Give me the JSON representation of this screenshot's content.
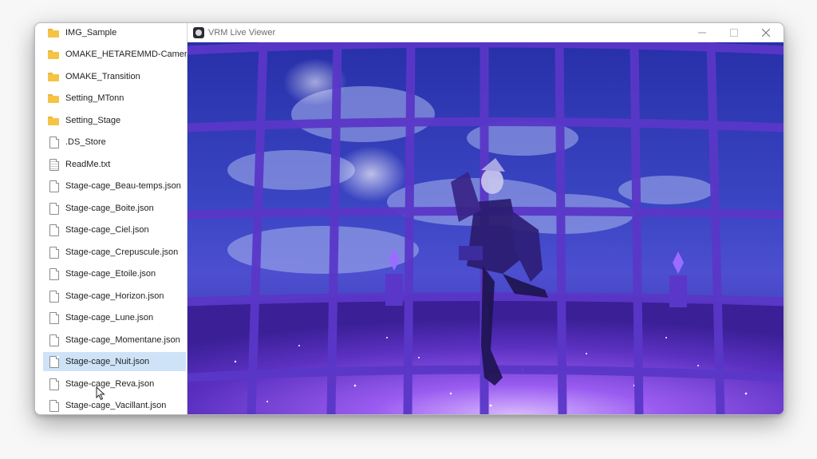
{
  "file_list": [
    {
      "name": "IMG_Sample",
      "type": "folder"
    },
    {
      "name": "OMAKE_HETAREMMD-Camera",
      "type": "folder"
    },
    {
      "name": "OMAKE_Transition",
      "type": "folder"
    },
    {
      "name": "Setting_MTonn",
      "type": "folder"
    },
    {
      "name": "Setting_Stage",
      "type": "folder"
    },
    {
      "name": ".DS_Store",
      "type": "file"
    },
    {
      "name": "ReadMe.txt",
      "type": "text"
    },
    {
      "name": "Stage-cage_Beau-temps.json",
      "type": "file"
    },
    {
      "name": "Stage-cage_Boite.json",
      "type": "file"
    },
    {
      "name": "Stage-cage_Ciel.json",
      "type": "file"
    },
    {
      "name": "Stage-cage_Crepuscule.json",
      "type": "file"
    },
    {
      "name": "Stage-cage_Etoile.json",
      "type": "file"
    },
    {
      "name": "Stage-cage_Horizon.json",
      "type": "file"
    },
    {
      "name": "Stage-cage_Lune.json",
      "type": "file"
    },
    {
      "name": "Stage-cage_Momentane.json",
      "type": "file"
    },
    {
      "name": "Stage-cage_Nuit.json",
      "type": "file",
      "selected": true
    },
    {
      "name": "Stage-cage_Reva.json",
      "type": "file"
    },
    {
      "name": "Stage-cage_Vacillant.json",
      "type": "file"
    }
  ],
  "viewer": {
    "title": "VRM Live Viewer",
    "app_icon": "vrm-app-icon",
    "controls": [
      "minimize-icon",
      "maximize-icon",
      "close-icon"
    ]
  },
  "colors": {
    "selection": "#cfe3f8",
    "folder": "#f5c445",
    "stage_sky": "#2a2fb0",
    "stage_grid": "#5b3ad0",
    "stage_floor": "#7b3fe0"
  }
}
